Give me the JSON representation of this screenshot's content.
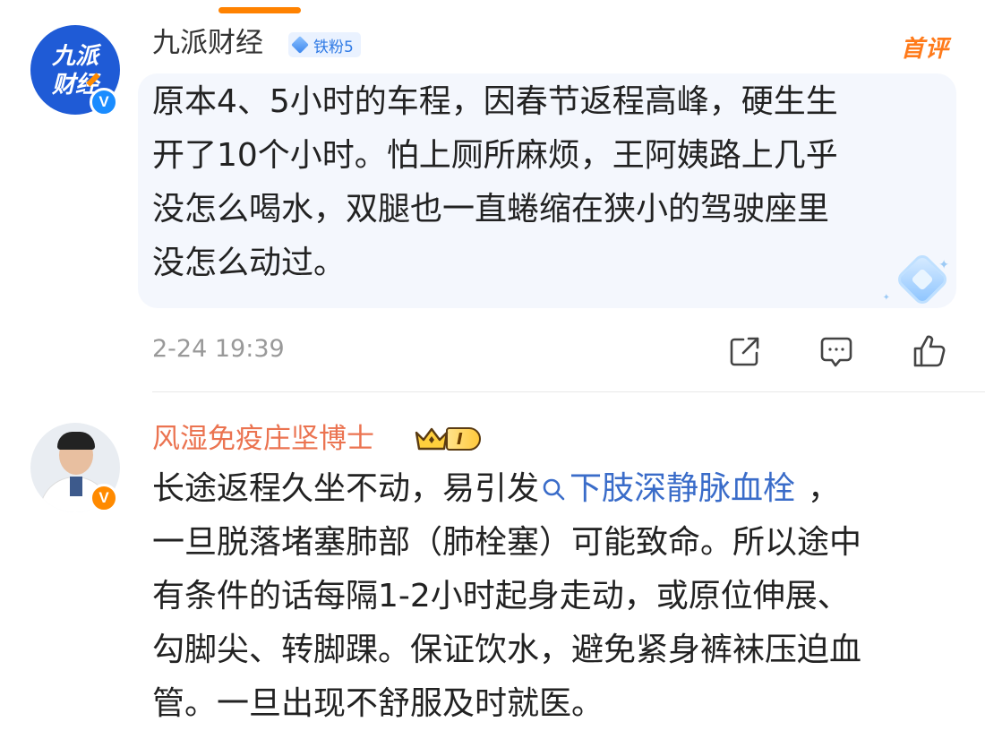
{
  "comments": [
    {
      "username": "九派财经",
      "avatar_text_top": "九派",
      "avatar_text_bottom": "财经",
      "fan_badge": "铁粉5",
      "first_comment_label": "首评",
      "content_lines": [
        "原本4、5小时的车程，因春节返程高峰，硬生生",
        "开了10个小时。怕上厕所麻烦，王阿姨路上几乎",
        "没怎么喝水，双腿也一直蜷缩在狭小的驾驶座里",
        "没怎么动过。"
      ],
      "timestamp": "2-24 19:39",
      "actions": [
        "share-icon",
        "comment-icon",
        "like-icon"
      ]
    },
    {
      "username": "风湿免疫庄坚博士",
      "vip_level": "I",
      "content_prefix": "长途返程久坐不动，易引发",
      "topic_link": "下肢深静脉血栓",
      "content_suffix": "，",
      "content_lines": [
        "一旦脱落堵塞肺部（肺栓塞）可能致命。所以途中",
        "有条件的话每隔1-2小时起身走动，或原位伸展、",
        "勾脚尖、转脚踝。保证饮水，避免紧身裤袜压迫血",
        "管。一旦出现不舒服及时就医。"
      ]
    }
  ],
  "colors": {
    "accent_orange": "#ff8200",
    "username_orange": "#eb7350",
    "link_blue": "#3a6cc9",
    "verified_blue": "#1a8cff",
    "verified_orange": "#ff8a00"
  }
}
